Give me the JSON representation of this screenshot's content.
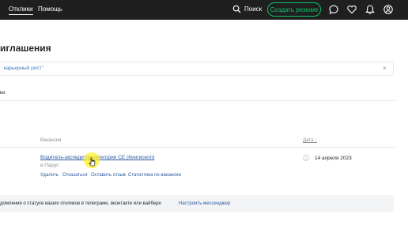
{
  "header": {
    "nav": [
      {
        "label": "Отклики",
        "active": true
      },
      {
        "label": "Помощь",
        "active": false
      }
    ],
    "search_label": "Поиск",
    "create_resume_label": "Создать резюме",
    "icons": [
      "search-icon",
      "chat-icon",
      "heart-icon",
      "bell-icon",
      "user-icon"
    ],
    "brand_color": "#0dc267"
  },
  "page": {
    "title": "иглашения"
  },
  "filter_chip": {
    "text": ": карьерный рост\"",
    "close": "×"
  },
  "filter_label": "ки",
  "table": {
    "columns": {
      "vacancy": "Вакансия",
      "date": "Дата ↓"
    },
    "rows": [
      {
        "vacancy": "Водитель-экспедитор категории СЕ (Кингисепп)",
        "company": "в Парус",
        "date": "14 апреля 2023",
        "actions": [
          "Удалить",
          "Отказаться",
          "Оставить отзыв",
          "Статистика по вакансии"
        ]
      }
    ]
  },
  "notice": {
    "text": "домления о статусе ваших откликов в телеграме, вконтакте или вайбере",
    "link": "Настроить мессенджер"
  }
}
